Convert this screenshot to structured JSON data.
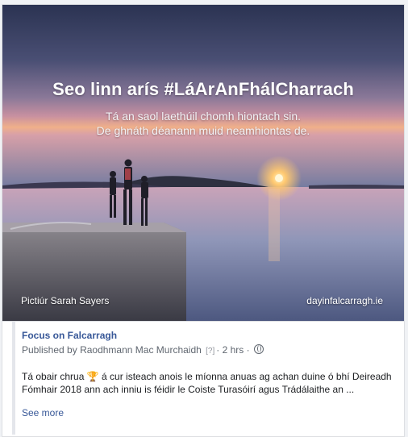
{
  "post": {
    "image": {
      "headline": "Seo linn arís #LáArAnFhálCharrach",
      "subline_1": "Tá an saol laethúil chomh hiontach sin.",
      "subline_2": "De ghnáth déanann muid neamhiontas de.",
      "credit": "Pictiúr Sarah Sayers",
      "site": "dayinfalcarragh.ie"
    },
    "page_name": "Focus on Falcarragh",
    "byline_prefix": "Published by",
    "author": "Raodhmann Mac Murchaidh",
    "help_marker": "[?]",
    "separator": "·",
    "time": "2 hrs",
    "text_part1": "Tá obair chrua",
    "emoji": "trophy-emoji",
    "text_part2": "á cur isteach anois le míonna anuas ag achan duine ó bhí Deireadh Fómhair 2018 ann ach inniu is féidir le Coiste Turasóirí agus Trádálaithe an ...",
    "see_more": "See more",
    "colors": {
      "link": "#385898",
      "meta": "#606770",
      "text": "#1c1e21"
    }
  }
}
